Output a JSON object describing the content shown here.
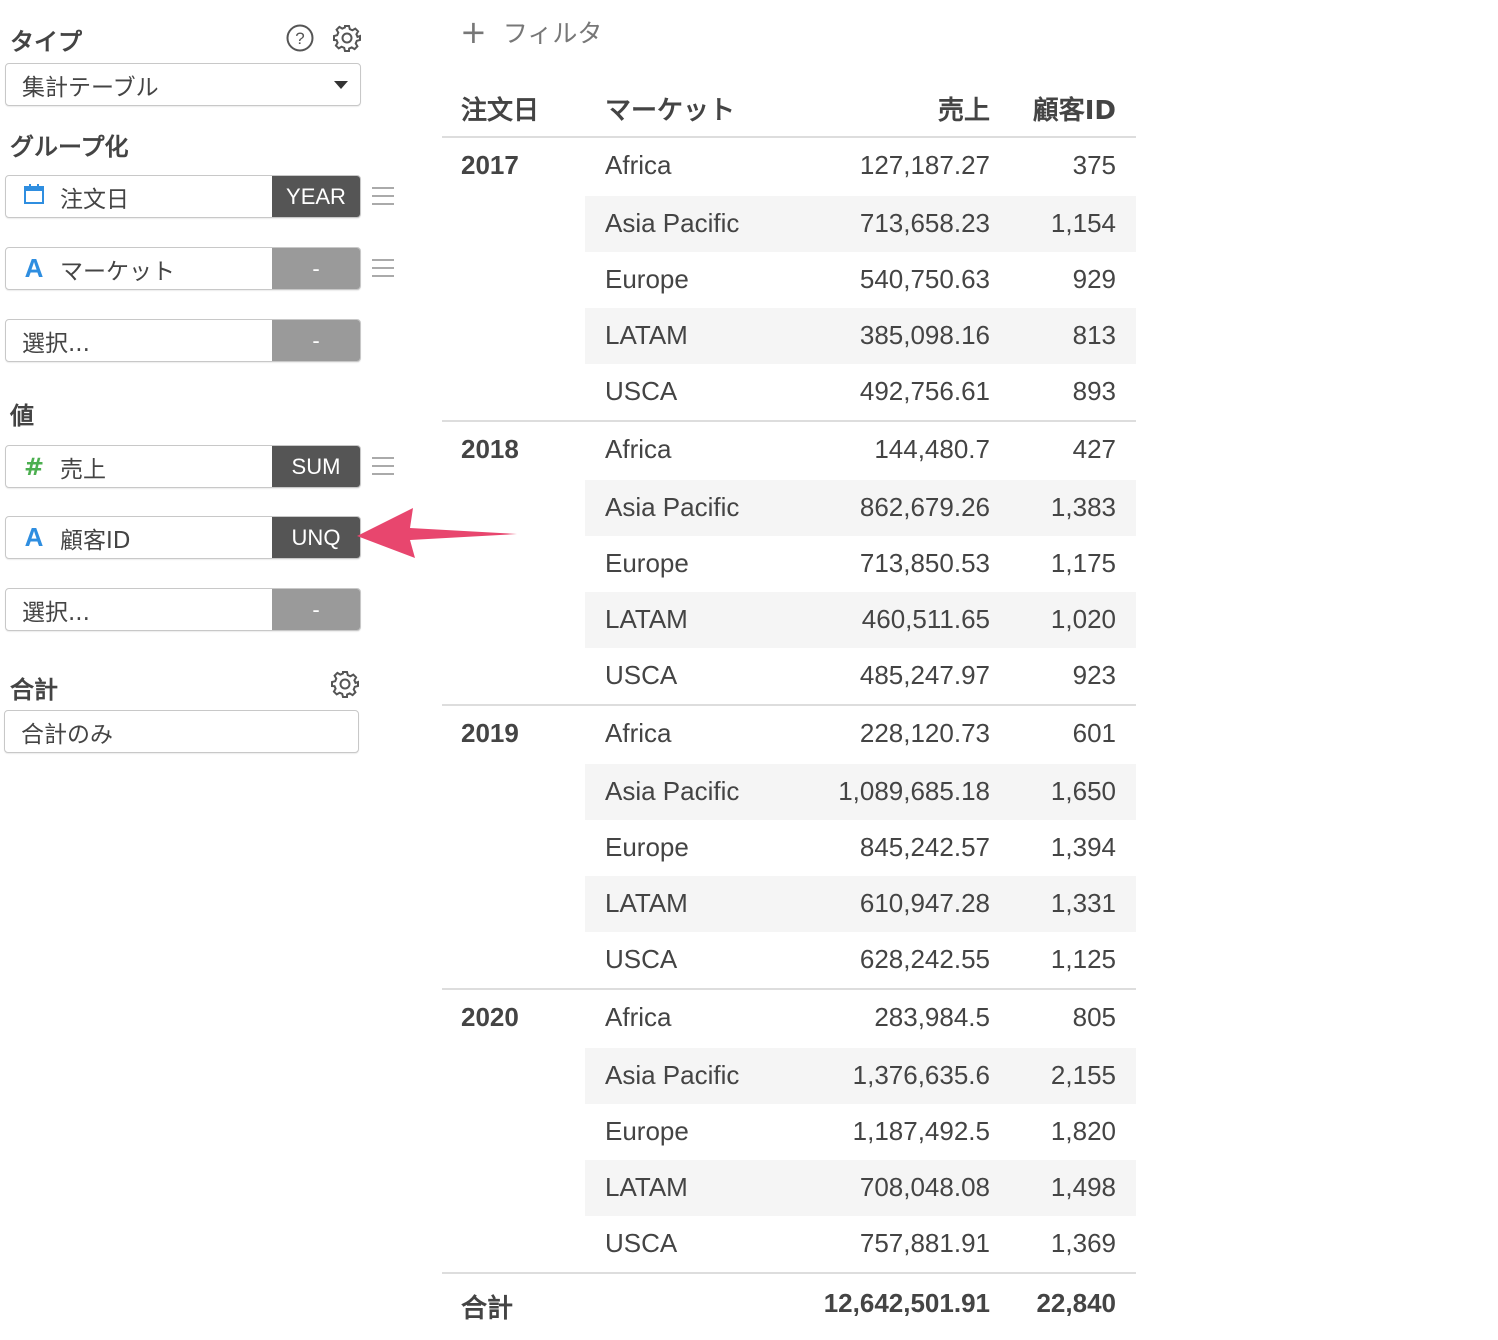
{
  "sidebar": {
    "type_title": "タイプ",
    "type_value": "集計テーブル",
    "group_title": "グループ化",
    "group_fields": [
      {
        "label": "注文日",
        "tag": "YEAR"
      },
      {
        "label": "マーケット",
        "tag": "-"
      },
      {
        "label": "選択...",
        "tag": "-"
      }
    ],
    "value_title": "値",
    "value_fields": [
      {
        "label": "売上",
        "tag": "SUM"
      },
      {
        "label": "顧客ID",
        "tag": "UNQ"
      },
      {
        "label": "選択...",
        "tag": "-"
      }
    ],
    "total_title": "合計",
    "total_value": "合計のみ",
    "icons": {
      "help": "help-icon",
      "settings": "gear-icon"
    }
  },
  "filter": {
    "label": "フィルタ"
  },
  "table": {
    "headers": [
      "注文日",
      "マーケット",
      "売上",
      "顧客ID"
    ],
    "groups": [
      {
        "year": "2017",
        "rows": [
          {
            "market": "Africa",
            "sales": "127,187.27",
            "customers": "375"
          },
          {
            "market": "Asia Pacific",
            "sales": "713,658.23",
            "customers": "1,154"
          },
          {
            "market": "Europe",
            "sales": "540,750.63",
            "customers": "929"
          },
          {
            "market": "LATAM",
            "sales": "385,098.16",
            "customers": "813"
          },
          {
            "market": "USCA",
            "sales": "492,756.61",
            "customers": "893"
          }
        ]
      },
      {
        "year": "2018",
        "rows": [
          {
            "market": "Africa",
            "sales": "144,480.7",
            "customers": "427"
          },
          {
            "market": "Asia Pacific",
            "sales": "862,679.26",
            "customers": "1,383"
          },
          {
            "market": "Europe",
            "sales": "713,850.53",
            "customers": "1,175"
          },
          {
            "market": "LATAM",
            "sales": "460,511.65",
            "customers": "1,020"
          },
          {
            "market": "USCA",
            "sales": "485,247.97",
            "customers": "923"
          }
        ]
      },
      {
        "year": "2019",
        "rows": [
          {
            "market": "Africa",
            "sales": "228,120.73",
            "customers": "601"
          },
          {
            "market": "Asia Pacific",
            "sales": "1,089,685.18",
            "customers": "1,650"
          },
          {
            "market": "Europe",
            "sales": "845,242.57",
            "customers": "1,394"
          },
          {
            "market": "LATAM",
            "sales": "610,947.28",
            "customers": "1,331"
          },
          {
            "market": "USCA",
            "sales": "628,242.55",
            "customers": "1,125"
          }
        ]
      },
      {
        "year": "2020",
        "rows": [
          {
            "market": "Africa",
            "sales": "283,984.5",
            "customers": "805"
          },
          {
            "market": "Asia Pacific",
            "sales": "1,376,635.6",
            "customers": "2,155"
          },
          {
            "market": "Europe",
            "sales": "1,187,492.5",
            "customers": "1,820"
          },
          {
            "market": "LATAM",
            "sales": "708,048.08",
            "customers": "1,498"
          },
          {
            "market": "USCA",
            "sales": "757,881.91",
            "customers": "1,369"
          }
        ]
      }
    ],
    "total": {
      "label": "合計",
      "sales": "12,642,501.91",
      "customers": "22,840"
    }
  },
  "colors": {
    "accent_arrow": "#e8466e",
    "tag_active": "#555555",
    "tag_inactive": "#9a9a9a",
    "date_icon": "#2f8ee0",
    "number_icon": "#4caf50"
  }
}
